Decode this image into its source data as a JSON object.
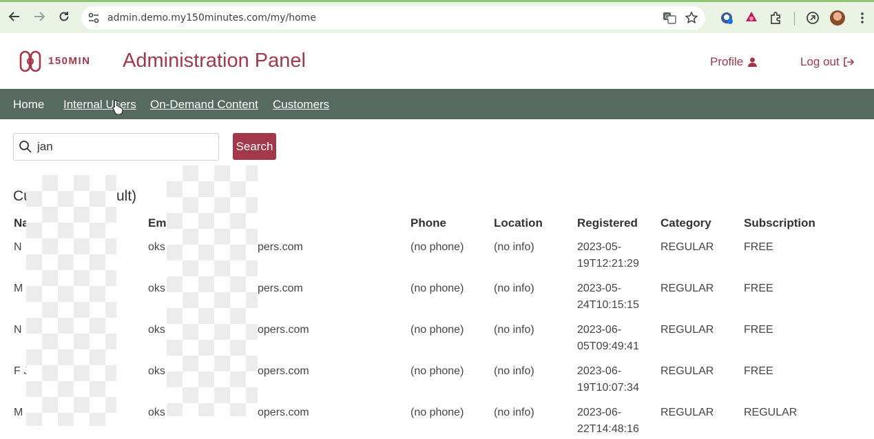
{
  "browser": {
    "url": "admin.demo.my150minutes.com/my/home"
  },
  "header": {
    "logo_text": "150MIN",
    "title": "Administration Panel",
    "profile_label": "Profile",
    "logout_label": "Log out"
  },
  "nav": {
    "items": [
      {
        "label": "Home"
      },
      {
        "label": "Internal Users"
      },
      {
        "label": "On-Demand Content"
      },
      {
        "label": "Customers"
      }
    ]
  },
  "search": {
    "value": "jan",
    "button_label": "Search"
  },
  "section": {
    "title_start": "Cu",
    "title_end": "ult)"
  },
  "table": {
    "columns": [
      "Na",
      "Ema",
      "Phone",
      "Location",
      "Registered",
      "Category",
      "Subscription"
    ],
    "rows": [
      {
        "name": "N",
        "email_start": "oks",
        "email_end": "pers.com",
        "phone": "(no phone)",
        "location": "(no info)",
        "registered_1": "2023-05-",
        "registered_2": "19T12:21:29",
        "category": "REGULAR",
        "subscription": "FREE"
      },
      {
        "name": "M",
        "email_start": "oks",
        "email_end": "pers.com",
        "phone": "(no phone)",
        "location": "(no info)",
        "registered_1": "2023-05-",
        "registered_2": "24T10:15:15",
        "category": "REGULAR",
        "subscription": "FREE"
      },
      {
        "name": "N",
        "email_start": "oks",
        "email_end": "opers.com",
        "phone": "(no phone)",
        "location": "(no info)",
        "registered_1": "2023-06-",
        "registered_2": "05T09:49:41",
        "category": "REGULAR",
        "subscription": "FREE"
      },
      {
        "name": "F J",
        "email_start": "oks",
        "email_end": "opers.com",
        "phone": "(no phone)",
        "location": "(no info)",
        "registered_1": "2023-06-",
        "registered_2": "19T10:07:34",
        "category": "REGULAR",
        "subscription": "FREE"
      },
      {
        "name": "M",
        "email_start": "oks",
        "email_end": "opers.com",
        "phone": "(no phone)",
        "location": "(no info)",
        "registered_1": "2023-06-",
        "registered_2": "22T14:48:16",
        "category": "REGULAR",
        "subscription": "REGULAR"
      }
    ]
  },
  "colors": {
    "brand": "#a2384a",
    "nav_bg": "#566a60",
    "chrome_bg": "#eaf3e4"
  },
  "icons": [
    "back-icon",
    "forward-icon",
    "reload-icon",
    "site-settings-icon",
    "translate-icon",
    "star-icon",
    "extension-icon",
    "puzzle-icon",
    "user-icon",
    "logout-icon",
    "search-icon"
  ]
}
